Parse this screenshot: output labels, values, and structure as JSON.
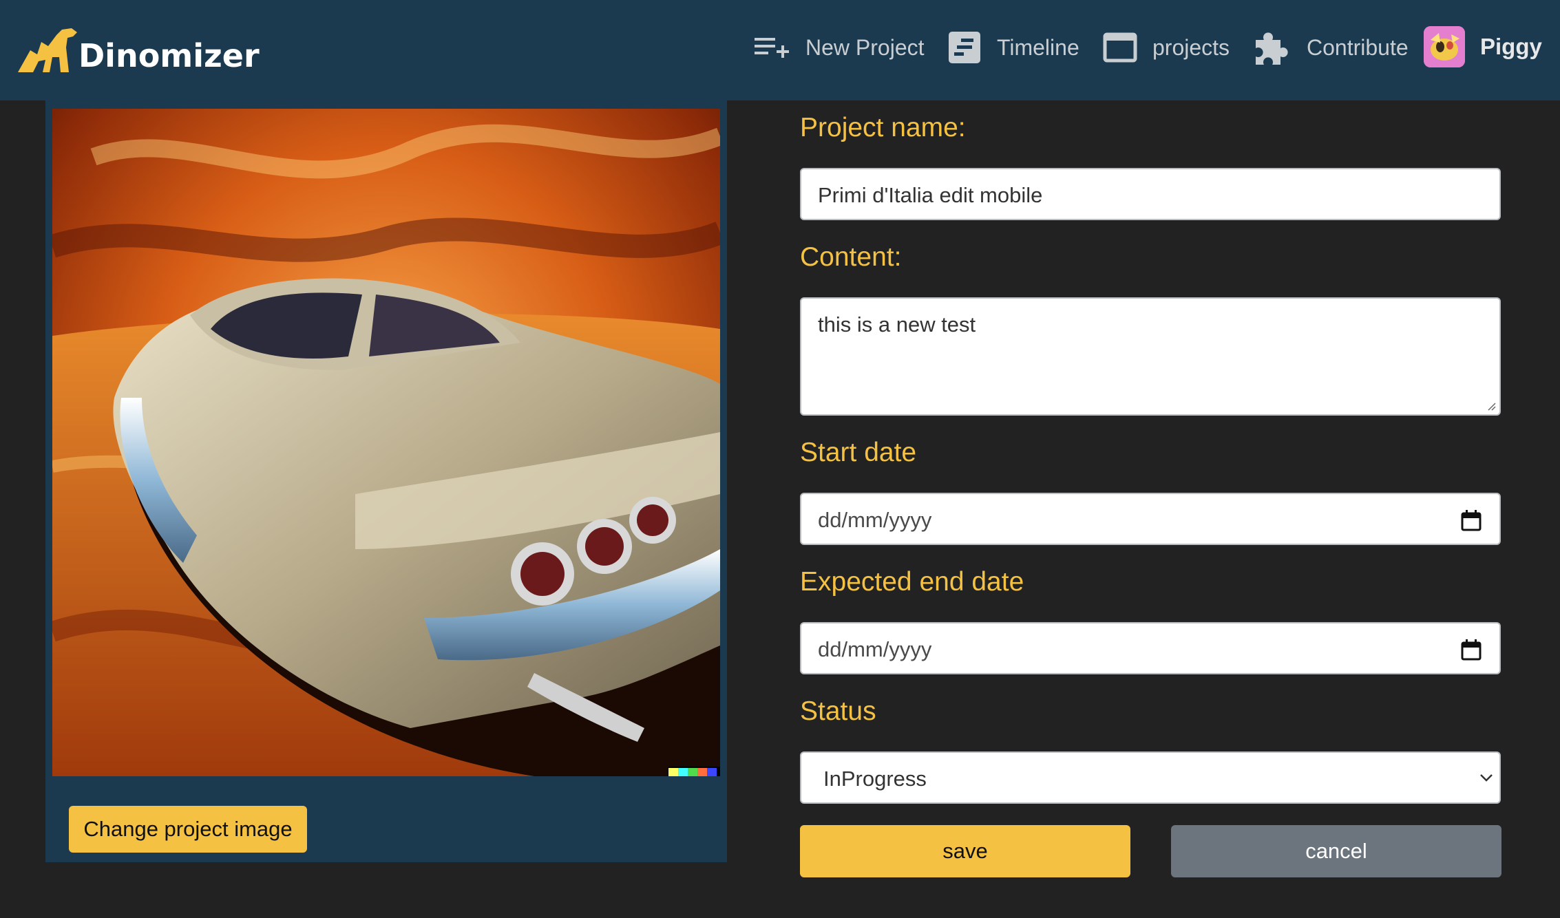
{
  "app": {
    "brand": "Dinomizer"
  },
  "nav": {
    "items": [
      {
        "label": "New Project",
        "icon": "playlist-add-icon"
      },
      {
        "label": "Timeline",
        "icon": "timeline-icon"
      },
      {
        "label": "projects",
        "icon": "window-icon"
      },
      {
        "label": "Contribute",
        "icon": "puzzle-icon"
      }
    ],
    "user": {
      "name": "Piggy",
      "avatar_icon": "piggy-avatar"
    }
  },
  "image_panel": {
    "change_button": "Change project image",
    "image_subject": "car-painting"
  },
  "form": {
    "name_label": "Project name:",
    "name_value": "Primi d'Italia edit mobile",
    "content_label": "Content:",
    "content_value": "this is a new test",
    "start_label": "Start date",
    "start_placeholder": "dd/mm/yyyy",
    "end_label": "Expected end date",
    "end_placeholder": "dd/mm/yyyy",
    "status_label": "Status",
    "status_value": "InProgress",
    "save_label": "save",
    "cancel_label": "cancel"
  },
  "colors": {
    "navbar": "#1c3a4f",
    "background": "#222222",
    "accent": "#f5c142",
    "cancel": "#6c757d"
  }
}
